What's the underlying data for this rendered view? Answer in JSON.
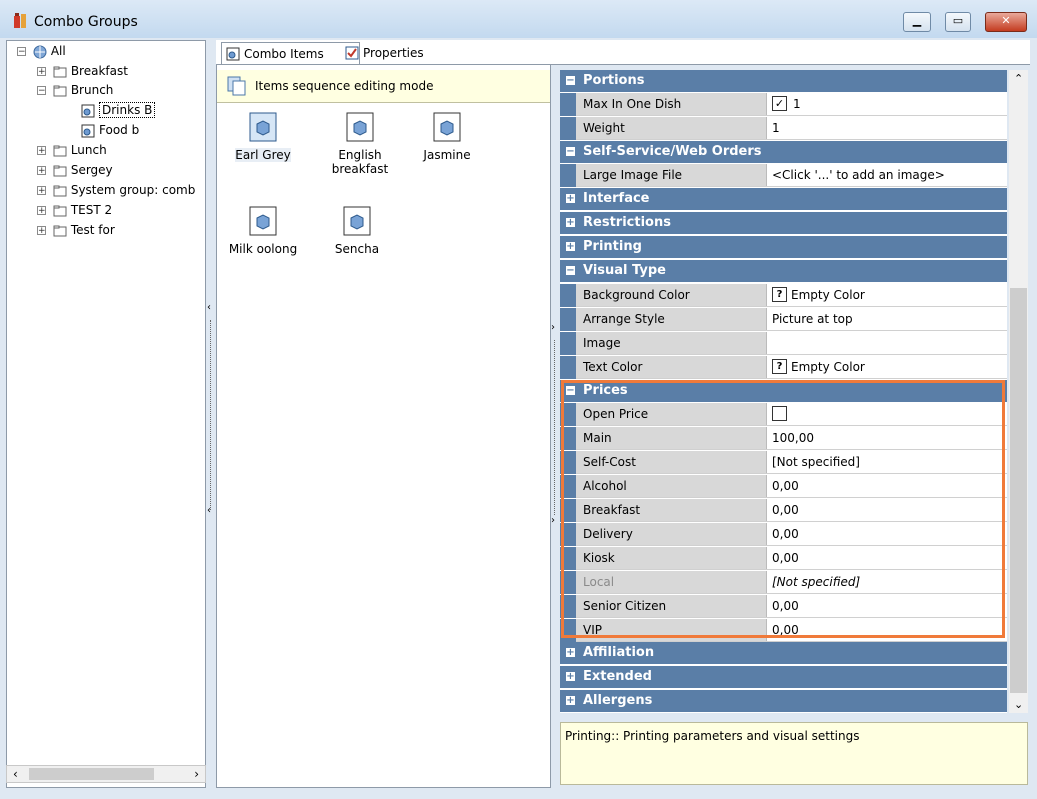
{
  "window": {
    "title": "Combo Groups"
  },
  "tree": {
    "root": "All",
    "nodes": [
      {
        "label": "Breakfast"
      },
      {
        "label": "Brunch"
      },
      {
        "label": "Drinks B"
      },
      {
        "label": "Food b"
      },
      {
        "label": "Lunch"
      },
      {
        "label": "Sergey"
      },
      {
        "label": "System group: comb"
      },
      {
        "label": "TEST 2"
      },
      {
        "label": "Test for"
      }
    ]
  },
  "tabs": [
    {
      "label": "Combo Items"
    },
    {
      "label": "Properties"
    }
  ],
  "sequence_bar": {
    "label": "Items sequence editing mode"
  },
  "combo_items": [
    {
      "label": "Earl Grey"
    },
    {
      "label": "English breakfast"
    },
    {
      "label": "Jasmine"
    },
    {
      "label": "Milk oolong"
    },
    {
      "label": "Sencha"
    }
  ],
  "grid": {
    "categories": {
      "portions": "Portions",
      "self_service": "Self-Service/Web Orders",
      "interface": "Interface",
      "restrictions": "Restrictions",
      "printing": "Printing",
      "visual_type": "Visual Type",
      "prices": "Prices",
      "affiliation": "Affiliation",
      "extended": "Extended",
      "allergens": "Allergens"
    },
    "portions": {
      "max_in_one_dish": {
        "name": "Max In One Dish",
        "value": "1",
        "checked": "✓"
      },
      "weight": {
        "name": "Weight",
        "value": "1"
      }
    },
    "self_service": {
      "large_image_file": {
        "name": "Large Image File",
        "value": "<Click '...' to add an image>"
      }
    },
    "visual_type": {
      "background_color": {
        "name": "Background Color",
        "value": "Empty Color"
      },
      "arrange_style": {
        "name": "Arrange Style",
        "value": "Picture at top"
      },
      "image": {
        "name": "Image",
        "value": ""
      },
      "text_color": {
        "name": "Text Color",
        "value": "Empty Color"
      },
      "question_mark": "?"
    },
    "prices": {
      "open_price": {
        "name": "Open Price",
        "value": ""
      },
      "main": {
        "name": "Main",
        "value": "100,00"
      },
      "self_cost": {
        "name": "Self-Cost",
        "value": "[Not specified]"
      },
      "alcohol": {
        "name": "Alcohol",
        "value": "0,00"
      },
      "breakfast": {
        "name": "Breakfast",
        "value": "0,00"
      },
      "delivery": {
        "name": "Delivery",
        "value": "0,00"
      },
      "kiosk": {
        "name": "Kiosk",
        "value": "0,00"
      },
      "local": {
        "name": "Local",
        "value": "[Not specified]"
      },
      "senior_citizen": {
        "name": "Senior Citizen",
        "value": "0,00"
      },
      "vip": {
        "name": "VIP",
        "value": "0,00"
      }
    }
  },
  "description": {
    "text": "Printing:: Printing parameters and visual settings"
  },
  "colors": {
    "category_bg": "#5a7ea7",
    "highlight": "#f07a3a",
    "info_bg": "#ffffe1"
  }
}
